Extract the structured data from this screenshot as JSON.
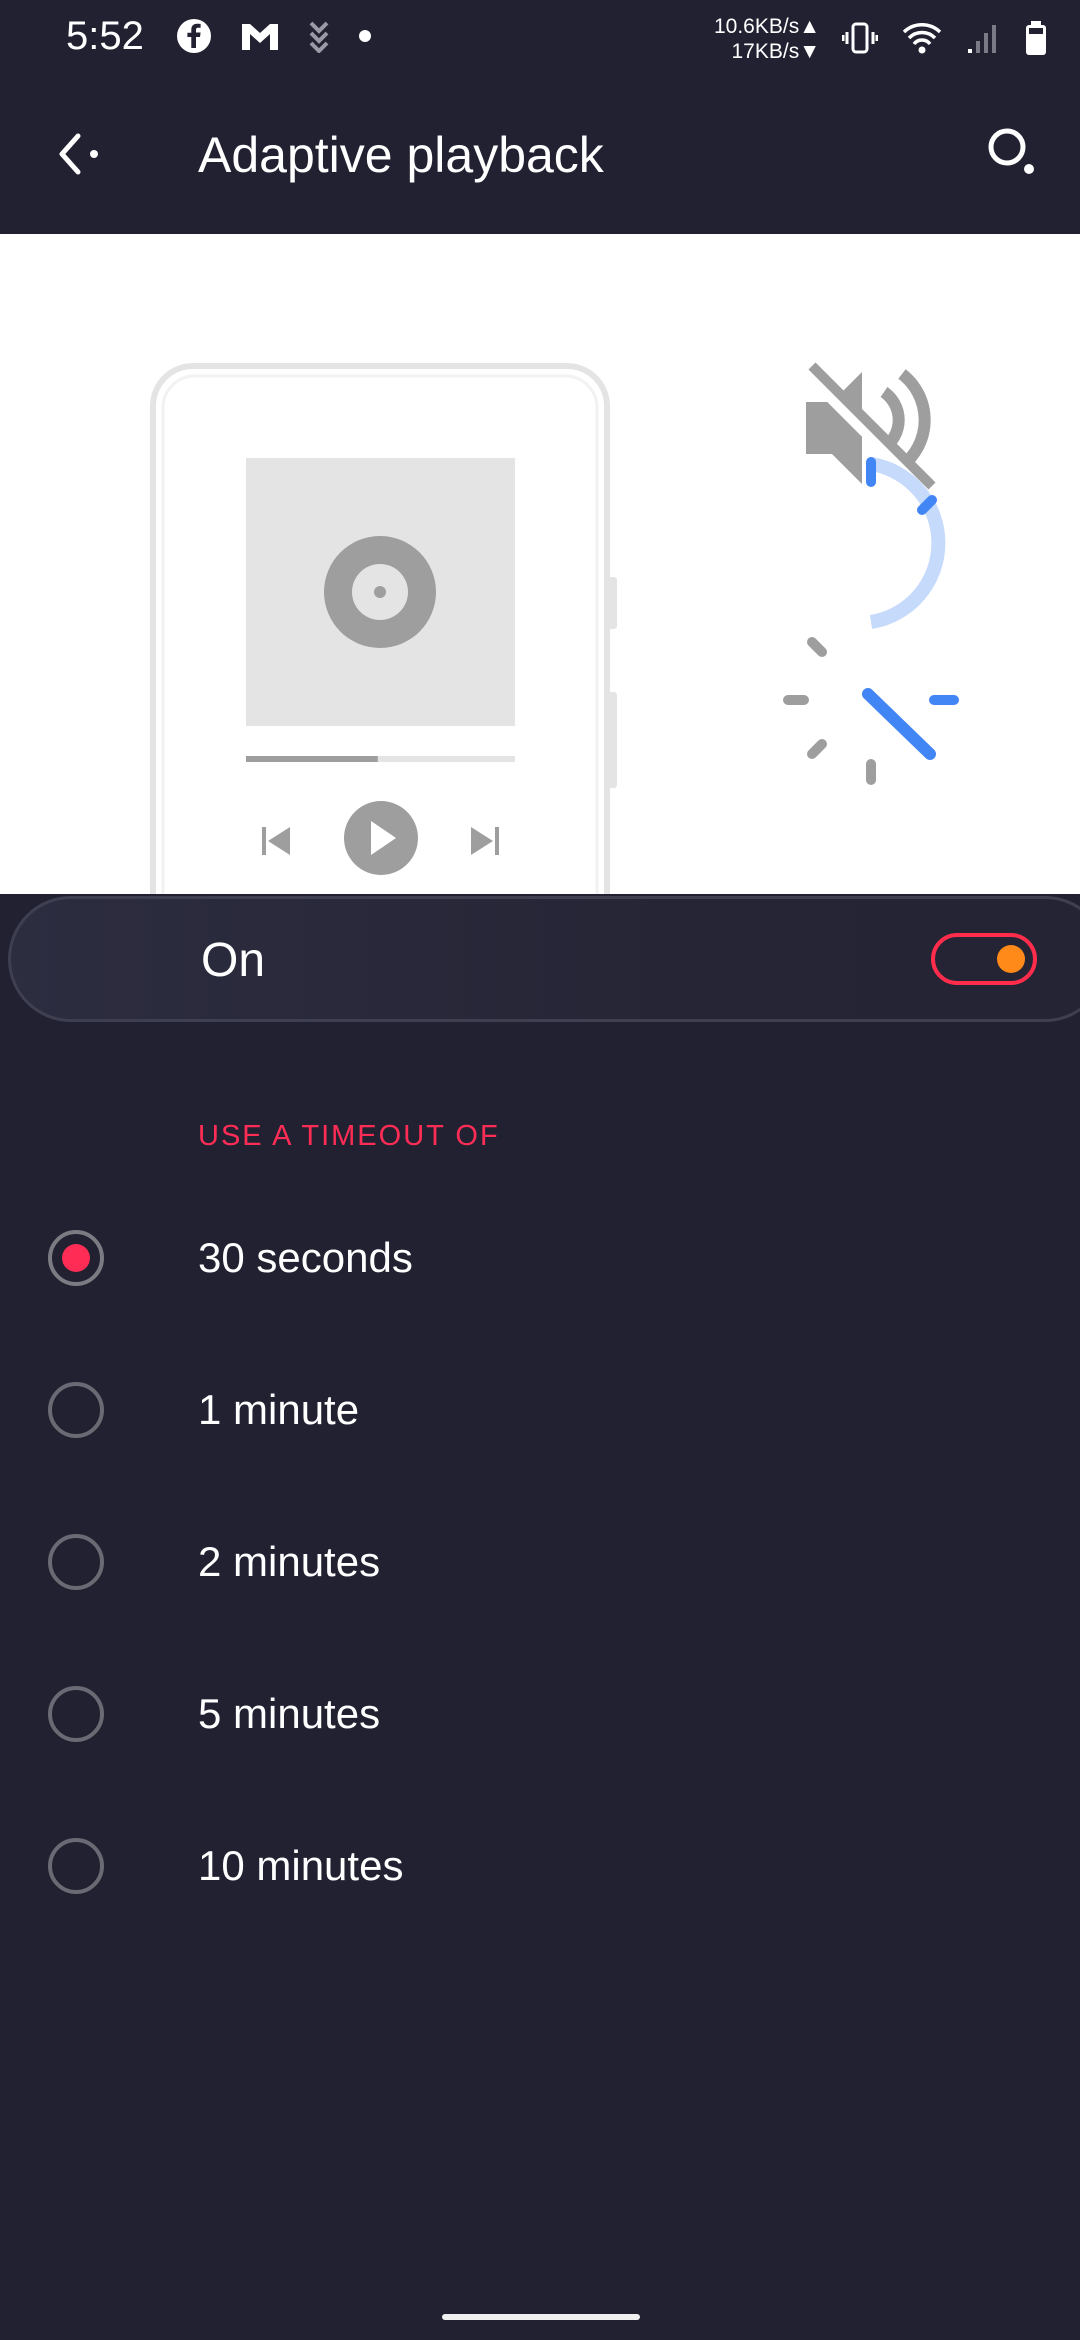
{
  "status_bar": {
    "time": "5:52",
    "net_up": "10.6KB/s▲",
    "net_down": "17KB/s▼",
    "left_icons": [
      "facebook-icon",
      "gmail-icon",
      "download-icon",
      "dot-icon"
    ],
    "right_icons": [
      "vibrate-icon",
      "wifi-icon",
      "signal-icon",
      "battery-icon"
    ]
  },
  "app_bar": {
    "title": "Adaptive playback",
    "back_icon": "back-arrow-icon",
    "search_icon": "search-icon"
  },
  "illustration": {
    "phone_icons": [
      "previous-icon",
      "play-icon",
      "next-icon"
    ],
    "progress": 0.49,
    "side_icons": [
      "mute-icon",
      "timer-icon"
    ],
    "colors": {
      "accent_blue": "#4285f4",
      "light_blue": "#c6dafc",
      "gray": "#9e9e9e"
    }
  },
  "main_switch": {
    "label": "On",
    "checked": true
  },
  "timeout": {
    "header": "USE A TIMEOUT OF",
    "options": [
      {
        "label": "30 seconds",
        "checked": true
      },
      {
        "label": "1 minute",
        "checked": false
      },
      {
        "label": "2 minutes",
        "checked": false
      },
      {
        "label": "5 minutes",
        "checked": false
      },
      {
        "label": "10 minutes",
        "checked": false
      }
    ]
  },
  "colors": {
    "background": "#212131",
    "accent_red": "#ff2d55",
    "accent_orange": "#ff8a1a"
  }
}
